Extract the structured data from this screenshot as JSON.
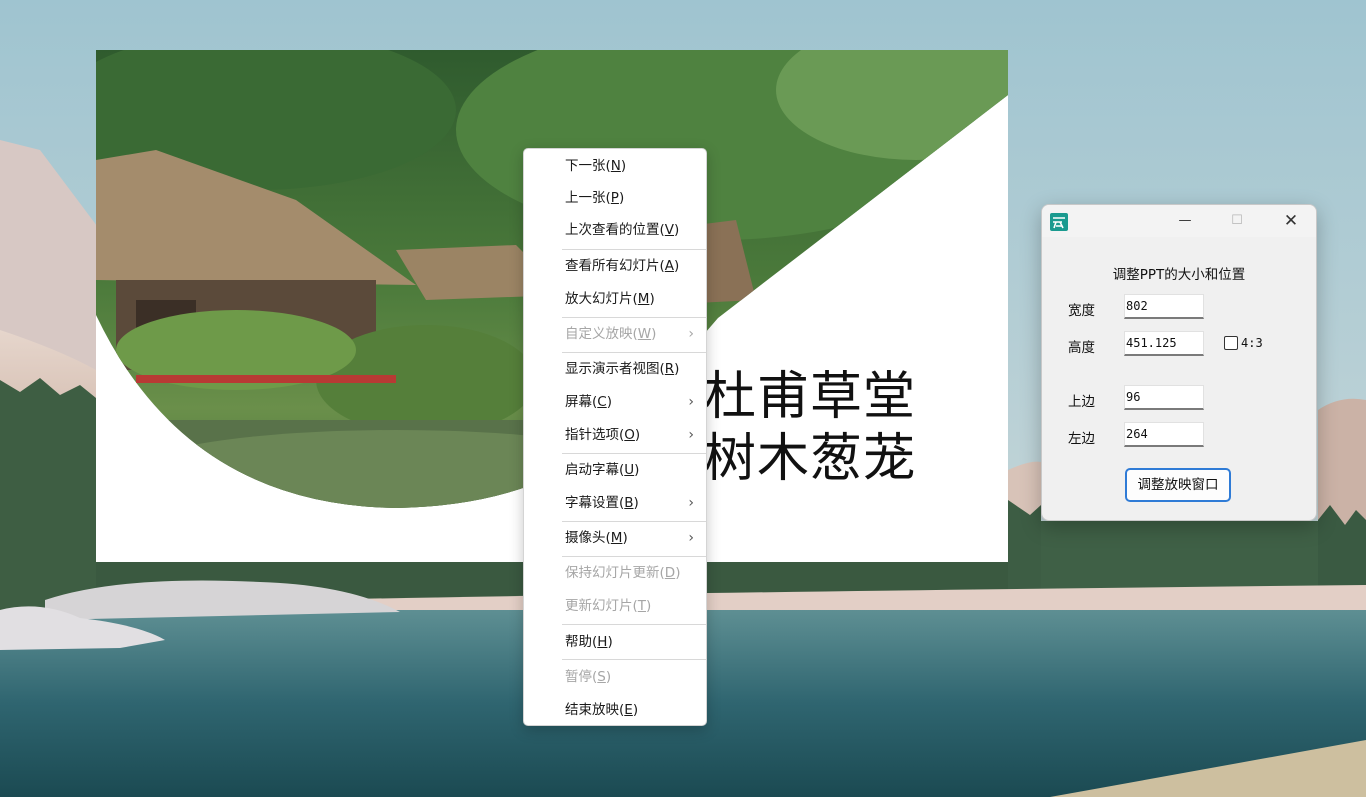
{
  "slide": {
    "title_line1": "杜甫草堂",
    "title_line2": "树木葱茏"
  },
  "context_menu": {
    "items": [
      {
        "label": "下一张(",
        "key": "N",
        "close": ")",
        "disabled": false,
        "submenu": false
      },
      {
        "label": "上一张(",
        "key": "P",
        "close": ")",
        "disabled": false,
        "submenu": false
      },
      {
        "label": "上次查看的位置(",
        "key": "V",
        "close": ")",
        "disabled": false,
        "submenu": false
      },
      {
        "label": "查看所有幻灯片(",
        "key": "A",
        "close": ")",
        "disabled": false,
        "submenu": false
      },
      {
        "label": "放大幻灯片(",
        "key": "M",
        "close": ")",
        "disabled": false,
        "submenu": false
      },
      {
        "label": "自定义放映(",
        "key": "W",
        "close": ")",
        "disabled": true,
        "submenu": true
      },
      {
        "label": "显示演示者视图(",
        "key": "R",
        "close": ")",
        "disabled": false,
        "submenu": false
      },
      {
        "label": "屏幕(",
        "key": "C",
        "close": ")",
        "disabled": false,
        "submenu": true
      },
      {
        "label": "指针选项(",
        "key": "O",
        "close": ")",
        "disabled": false,
        "submenu": true
      },
      {
        "label": "启动字幕(",
        "key": "U",
        "close": ")",
        "disabled": false,
        "submenu": false
      },
      {
        "label": "字幕设置(",
        "key": "B",
        "close": ")",
        "disabled": false,
        "submenu": true
      },
      {
        "label": "摄像头(",
        "key": "M",
        "close": ")",
        "disabled": false,
        "submenu": true
      },
      {
        "label": "保持幻灯片更新(",
        "key": "D",
        "close": ")",
        "disabled": true,
        "submenu": false
      },
      {
        "label": "更新幻灯片(",
        "key": "T",
        "close": ")",
        "disabled": true,
        "submenu": false
      },
      {
        "label": "帮助(",
        "key": "H",
        "close": ")",
        "disabled": false,
        "submenu": false
      },
      {
        "label": "暂停(",
        "key": "S",
        "close": ")",
        "disabled": true,
        "submenu": false
      },
      {
        "label": "结束放映(",
        "key": "E",
        "close": ")",
        "disabled": false,
        "submenu": false
      }
    ],
    "submenu_arrow": "›"
  },
  "dialog": {
    "minimize_glyph": "—",
    "maximize_glyph": "☐",
    "close_glyph": "✕",
    "heading": "调整PPT的大小和位置",
    "width_label": "宽度",
    "width_value": "802",
    "height_label": "高度",
    "height_value": "451.125",
    "aspect_label": "4:3",
    "aspect_checked": false,
    "top_label": "上边",
    "top_value": "96",
    "left_label": "左边",
    "left_value": "264",
    "apply_button": "调整放映窗口"
  }
}
